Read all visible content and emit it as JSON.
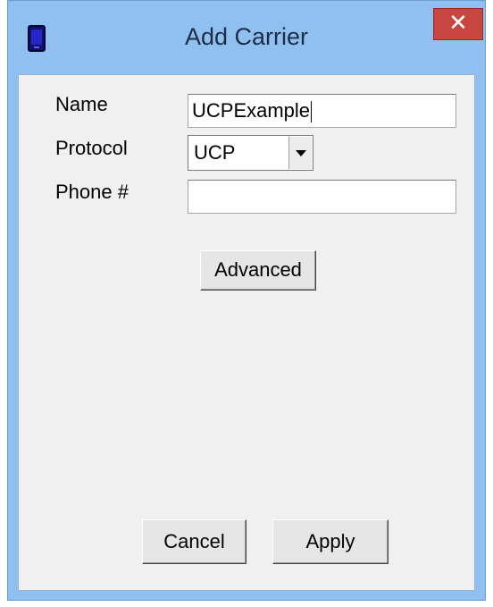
{
  "window": {
    "title": "Add Carrier",
    "close_symbol": "✕"
  },
  "form": {
    "name_label": "Name",
    "name_value": "UCPExample",
    "protocol_label": "Protocol",
    "protocol_value": "UCP",
    "phone_label": "Phone #",
    "phone_value": ""
  },
  "buttons": {
    "advanced": "Advanced",
    "cancel": "Cancel",
    "apply": "Apply"
  },
  "colors": {
    "title_bar": "#8fc0f0",
    "close_button": "#c9453f",
    "client_area": "#f0f0f0"
  },
  "icons": {
    "app": "mobile-phone-icon",
    "close": "close-icon",
    "dropdown": "chevron-down-icon"
  }
}
